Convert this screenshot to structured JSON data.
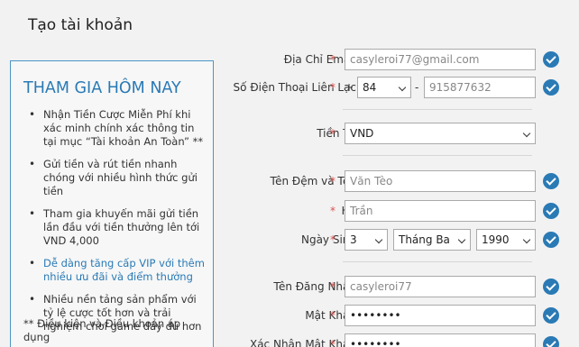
{
  "page": {
    "title": "Tạo tài khoản"
  },
  "promo": {
    "title": "THAM GIA HÔM NAY",
    "items": [
      "Nhận Tiền Cược Miễn Phí khi xác minh chính xác thông tin tại mục “Tài khoản An Toàn” **",
      "Gửi tiền và rút tiền nhanh chóng với nhiều hình thức gửi tiền",
      "Tham gia khuyến mãi gửi tiền lần đầu với tiền thưởng lên tới VND 4,000",
      "Dễ dàng tăng cấp VIP với thêm nhiều ưu đãi và điểm thưởng",
      "Nhiều nền tảng sản phẩm với tỷ lệ cược tốt hơn và trải nghiệm chơi game đầy đủ hơn"
    ],
    "note": "** Điều kiện và Điều khoản áp dụng"
  },
  "form": {
    "required_mark": "*",
    "email": {
      "label": "Địa Chỉ Email",
      "value": "casyleroi77@gmail.com"
    },
    "phone": {
      "label": "Số Điện Thoại Liên Lạc",
      "plus": "+",
      "code": "84",
      "dash": "-",
      "number": "915877632"
    },
    "currency": {
      "label": "Tiền Tệ",
      "value": "VND"
    },
    "middle_name": {
      "label": "Tên Đệm và Tên",
      "value": "Văn Tèo"
    },
    "last_name": {
      "label": "Họ",
      "value": "Trần"
    },
    "birthday": {
      "label": "Ngày Sinh",
      "day": "3",
      "month": "Tháng Ba",
      "year": "1990"
    },
    "username": {
      "label": "Tên Đăng Nhập",
      "value": "casyleroi77"
    },
    "password": {
      "label": "Mật Khẩu",
      "value": "••••••••"
    },
    "confirm_password": {
      "label": "Xác Nhận Mật Khẩu",
      "value": "••••••••"
    }
  },
  "colors": {
    "accent": "#2a7ab5",
    "required": "#d9534f",
    "background": "#f2f2f2"
  }
}
